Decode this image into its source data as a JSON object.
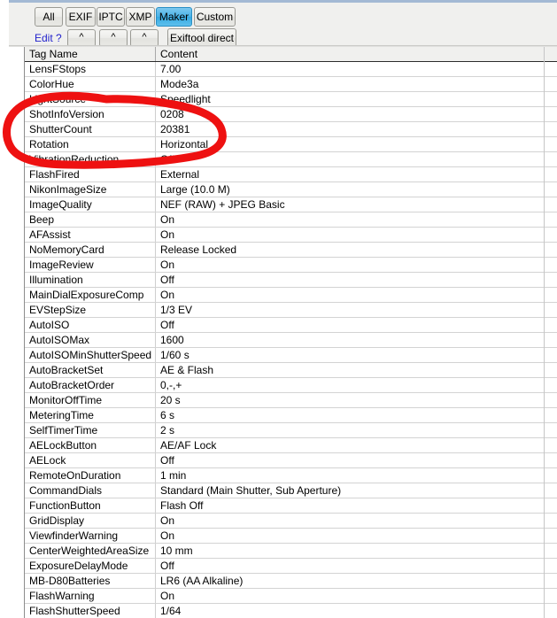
{
  "app": {
    "accent_selected": "#3fb0e6",
    "annotation_color": "#ee1111"
  },
  "toolbar": {
    "tabs": [
      {
        "label": "All",
        "selected": false
      },
      {
        "label": "EXIF",
        "selected": false
      },
      {
        "label": "IPTC",
        "selected": false
      },
      {
        "label": "XMP",
        "selected": false
      },
      {
        "label": "Maker",
        "selected": true
      },
      {
        "label": "Custom",
        "selected": false
      }
    ],
    "edit_label": "Edit ?",
    "up_buttons": [
      "^",
      "^",
      "^"
    ],
    "exiftool_label": "Exiftool direct"
  },
  "table": {
    "columns": [
      "Tag Name",
      "Content"
    ],
    "rows": [
      [
        "LensFStops",
        "7.00"
      ],
      [
        "ColorHue",
        "Mode3a"
      ],
      [
        "LightSource",
        "Speedlight"
      ],
      [
        "ShotInfoVersion",
        "0208"
      ],
      [
        "ShutterCount",
        "20381"
      ],
      [
        "Rotation",
        "Horizontal"
      ],
      [
        "VibrationReduction",
        "Off"
      ],
      [
        "FlashFired",
        "External"
      ],
      [
        "NikonImageSize",
        "Large (10.0 M)"
      ],
      [
        "ImageQuality",
        "NEF (RAW) + JPEG Basic"
      ],
      [
        "Beep",
        "On"
      ],
      [
        "AFAssist",
        "On"
      ],
      [
        "NoMemoryCard",
        "Release Locked"
      ],
      [
        "ImageReview",
        "On"
      ],
      [
        "Illumination",
        "Off"
      ],
      [
        "MainDialExposureComp",
        "On"
      ],
      [
        "EVStepSize",
        "1/3 EV"
      ],
      [
        "AutoISO",
        "Off"
      ],
      [
        "AutoISOMax",
        "1600"
      ],
      [
        "AutoISOMinShutterSpeed",
        "1/60 s"
      ],
      [
        "AutoBracketSet",
        "AE & Flash"
      ],
      [
        "AutoBracketOrder",
        "0,-,+"
      ],
      [
        "MonitorOffTime",
        "20 s"
      ],
      [
        "MeteringTime",
        "6 s"
      ],
      [
        "SelfTimerTime",
        "2 s"
      ],
      [
        "AELockButton",
        "AE/AF Lock"
      ],
      [
        "AELock",
        "Off"
      ],
      [
        "RemoteOnDuration",
        "1 min"
      ],
      [
        "CommandDials",
        "Standard (Main Shutter, Sub Aperture)"
      ],
      [
        "FunctionButton",
        "Flash Off"
      ],
      [
        "GridDisplay",
        "On"
      ],
      [
        "ViewfinderWarning",
        "On"
      ],
      [
        "CenterWeightedAreaSize",
        "10 mm"
      ],
      [
        "ExposureDelayMode",
        "Off"
      ],
      [
        "MB-D80Batteries",
        "LR6 (AA Alkaline)"
      ],
      [
        "FlashWarning",
        "On"
      ],
      [
        "FlashShutterSpeed",
        "1/64"
      ]
    ]
  },
  "annotation": {
    "shape": "hand-drawn-ellipse",
    "encircles": [
      "ShotInfoVersion",
      "ShutterCount",
      "Rotation"
    ]
  }
}
